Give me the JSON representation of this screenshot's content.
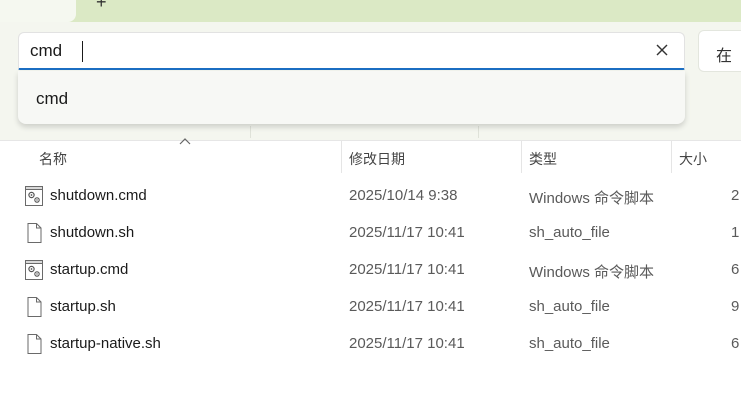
{
  "tabs": {
    "close_glyph": "✕",
    "new_tab_glyph": "+"
  },
  "search": {
    "value": "cmd",
    "placeholder": "",
    "suggestion": "cmd"
  },
  "right_button": {
    "label": "在"
  },
  "columns": {
    "name": "名称",
    "date": "修改日期",
    "type": "类型",
    "size": "大小"
  },
  "files": [
    {
      "name": "shutdown.cmd",
      "date": "2025/10/14 9:38",
      "type": "Windows 命令脚本",
      "size": "2",
      "icon": "cmd-script-icon"
    },
    {
      "name": "shutdown.sh",
      "date": "2025/11/17 10:41",
      "type": "sh_auto_file",
      "size": "1",
      "icon": "blank-file-icon"
    },
    {
      "name": "startup.cmd",
      "date": "2025/11/17 10:41",
      "type": "Windows 命令脚本",
      "size": "6",
      "icon": "cmd-script-icon"
    },
    {
      "name": "startup.sh",
      "date": "2025/11/17 10:41",
      "type": "sh_auto_file",
      "size": "9",
      "icon": "blank-file-icon"
    },
    {
      "name": "startup-native.sh",
      "date": "2025/11/17 10:41",
      "type": "sh_auto_file",
      "size": "6",
      "icon": "blank-file-icon"
    }
  ],
  "colors": {
    "tab_strip": "#dbe9c5",
    "toolbar": "#f4f6ef",
    "focus_accent": "#1b6ec2"
  }
}
